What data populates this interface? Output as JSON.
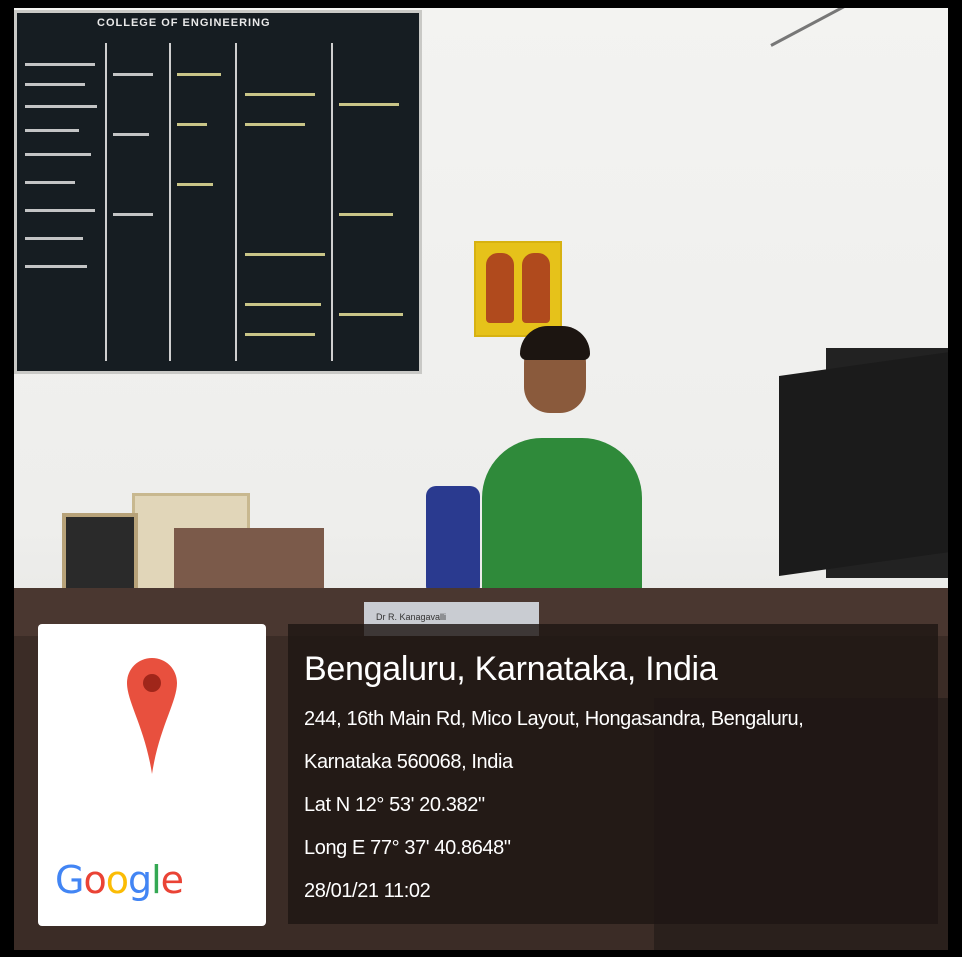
{
  "board": {
    "title": "COLLEGE OF ENGINEERING"
  },
  "name_plate": {
    "text": "Dr R. Kanagavalli"
  },
  "overlay": {
    "logo": {
      "letters": [
        "G",
        "o",
        "o",
        "g",
        "l",
        "e"
      ],
      "colors": [
        "#4285F4",
        "#EA4335",
        "#FBBC05",
        "#4285F4",
        "#34A853",
        "#EA4335"
      ]
    },
    "pin_color": "#E8503E",
    "location_title": "Bengaluru, Karnataka, India",
    "address_line1": "244, 16th Main Rd, Mico Layout, Hongasandra, Bengaluru,",
    "address_line2": "Karnataka 560068, India",
    "latitude": "Lat N 12° 53' 20.382\"",
    "longitude": "Long E 77° 37' 40.8648\"",
    "timestamp": "28/01/21 11:02"
  }
}
